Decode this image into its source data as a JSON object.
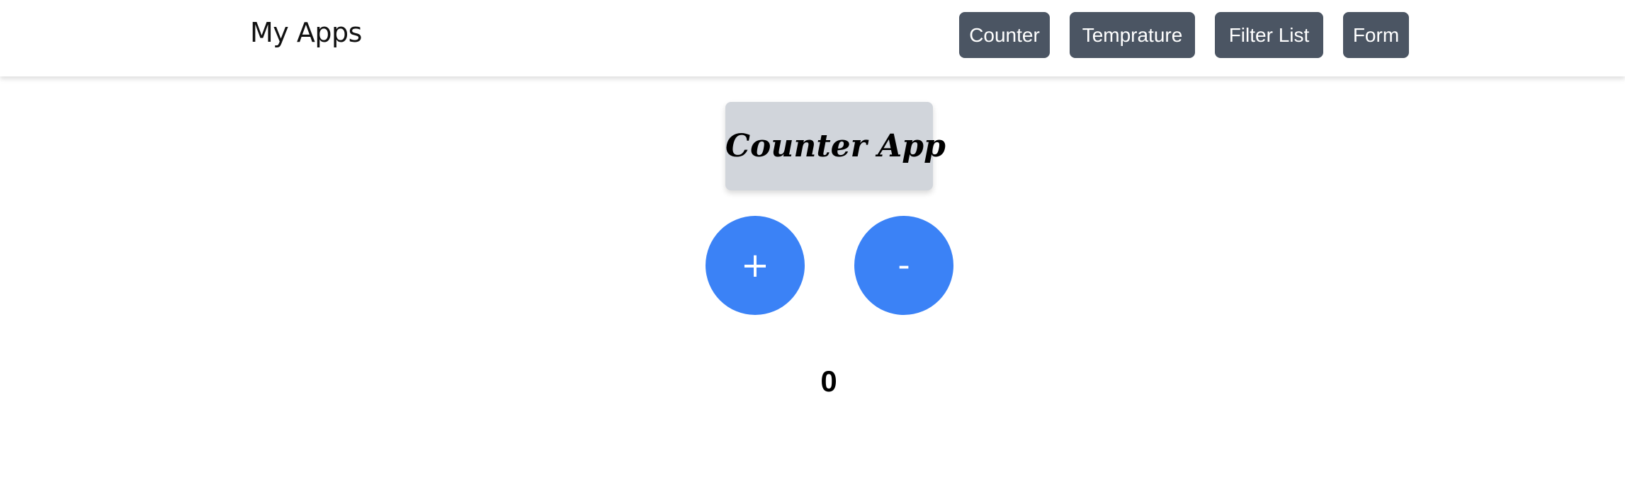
{
  "navbar": {
    "brand": "My Apps",
    "items": [
      {
        "label": "Counter"
      },
      {
        "label": "Temprature"
      },
      {
        "label": "Filter List"
      },
      {
        "label": "Form"
      }
    ]
  },
  "counter_app": {
    "title": "Counter App",
    "increment_label": "+",
    "decrement_label": "-",
    "count": "0"
  },
  "colors": {
    "nav_button_bg": "#4b5563",
    "circle_button_bg": "#3b82f6",
    "title_card_bg": "#d1d5db"
  }
}
